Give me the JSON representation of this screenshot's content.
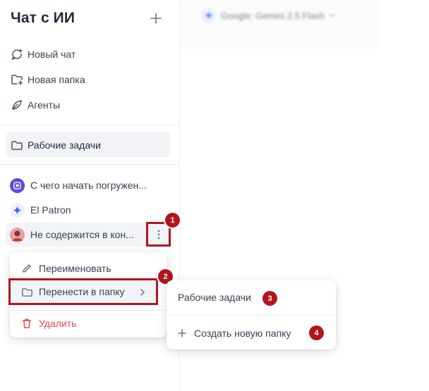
{
  "sidebar": {
    "title": "Чат с ИИ",
    "nav": [
      {
        "label": "Новый чат",
        "icon": "new-chat-icon"
      },
      {
        "label": "Новая папка",
        "icon": "new-folder-icon"
      },
      {
        "label": "Агенты",
        "icon": "agents-icon"
      }
    ],
    "folder": {
      "label": "Рабочие задачи",
      "icon": "folder-icon"
    },
    "chats": [
      {
        "label": "С чего начать погружен...",
        "avatar": "bot-avatar-icon"
      },
      {
        "label": "El Patron",
        "avatar": "gemini-avatar-icon"
      },
      {
        "label": "Не содержится в кон...",
        "avatar": "user-avatar"
      }
    ]
  },
  "context_menu": {
    "rename": "Переименовать",
    "move": "Перенести в папку",
    "delete": "Удалить"
  },
  "submenu": {
    "folder": "Рабочие задачи",
    "create": "Создать новую папку"
  },
  "model": {
    "label": "Google: Gemini 2.5 Flash"
  },
  "badges": [
    "1",
    "2",
    "3",
    "4"
  ],
  "colors": {
    "annotation": "#b3151d",
    "danger": "#e5484d",
    "accent": "#3b6cf6"
  }
}
